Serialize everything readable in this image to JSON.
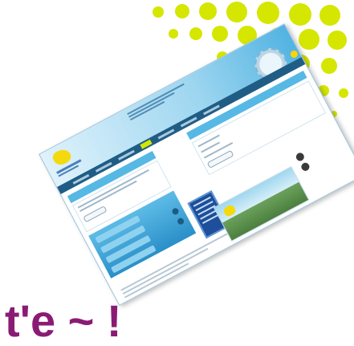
{
  "colors": {
    "dots": "#d5e600",
    "header_blue": "#56b8e4",
    "nav_dark": "#1f5d86",
    "accent_yellow": "#ffd400",
    "bottom_text": "#8a1b74"
  },
  "bottom_text": "t'e ~  !",
  "icons": [
    "logo-icon",
    "sun-icon",
    "badge-icon"
  ]
}
